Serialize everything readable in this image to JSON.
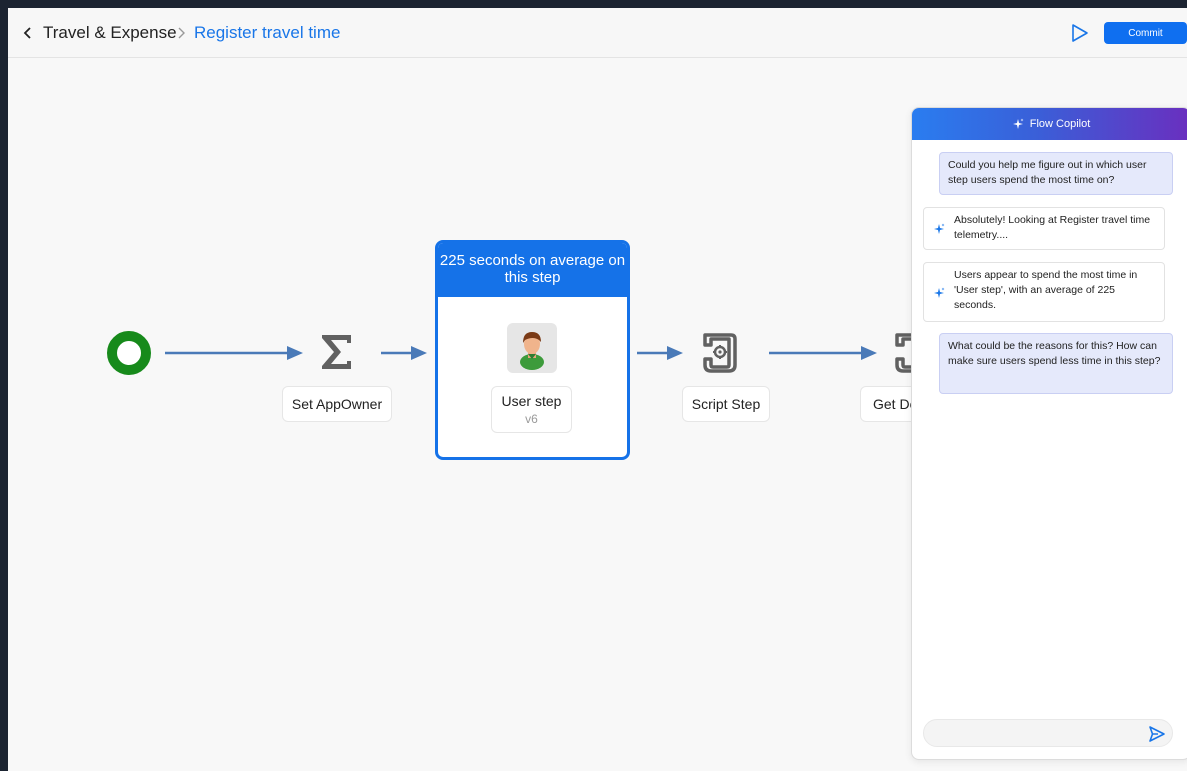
{
  "header": {
    "back_icon": "chevron-left-icon",
    "breadcrumb_root": "Travel & Expense",
    "breadcrumb_current": "Register travel time",
    "run_icon": "play-icon",
    "commit_label": "Commit",
    "accent": "#1976e8"
  },
  "flow": {
    "start_color": "#178a1b",
    "edge_color": "#4a7ab8",
    "steps": [
      {
        "label": "Set AppOwner",
        "icon": "sigma-icon"
      },
      {
        "label": "User step",
        "version": "v6",
        "icon": "user-avatar-icon",
        "highlight": "225 seconds on average on this step"
      },
      {
        "label": "Script Step",
        "icon": "script-scroll-icon"
      },
      {
        "label": "Get De",
        "icon": "script-scroll-icon"
      }
    ]
  },
  "copilot": {
    "title": "Flow Copilot",
    "title_icon": "sparkle-icon",
    "messages": [
      {
        "role": "user",
        "text": "Could you help me figure out in which user step users spend the most time on?"
      },
      {
        "role": "assistant",
        "text": "Absolutely! Looking at Register travel time telemetry...."
      },
      {
        "role": "assistant",
        "text": "Users appear to spend the most time in 'User step', with an average of 225 seconds."
      },
      {
        "role": "user",
        "text": "What could be the reasons for this? How can make sure users spend less time in this step?"
      }
    ],
    "input_value": "",
    "input_placeholder": "",
    "send_icon": "send-icon"
  }
}
